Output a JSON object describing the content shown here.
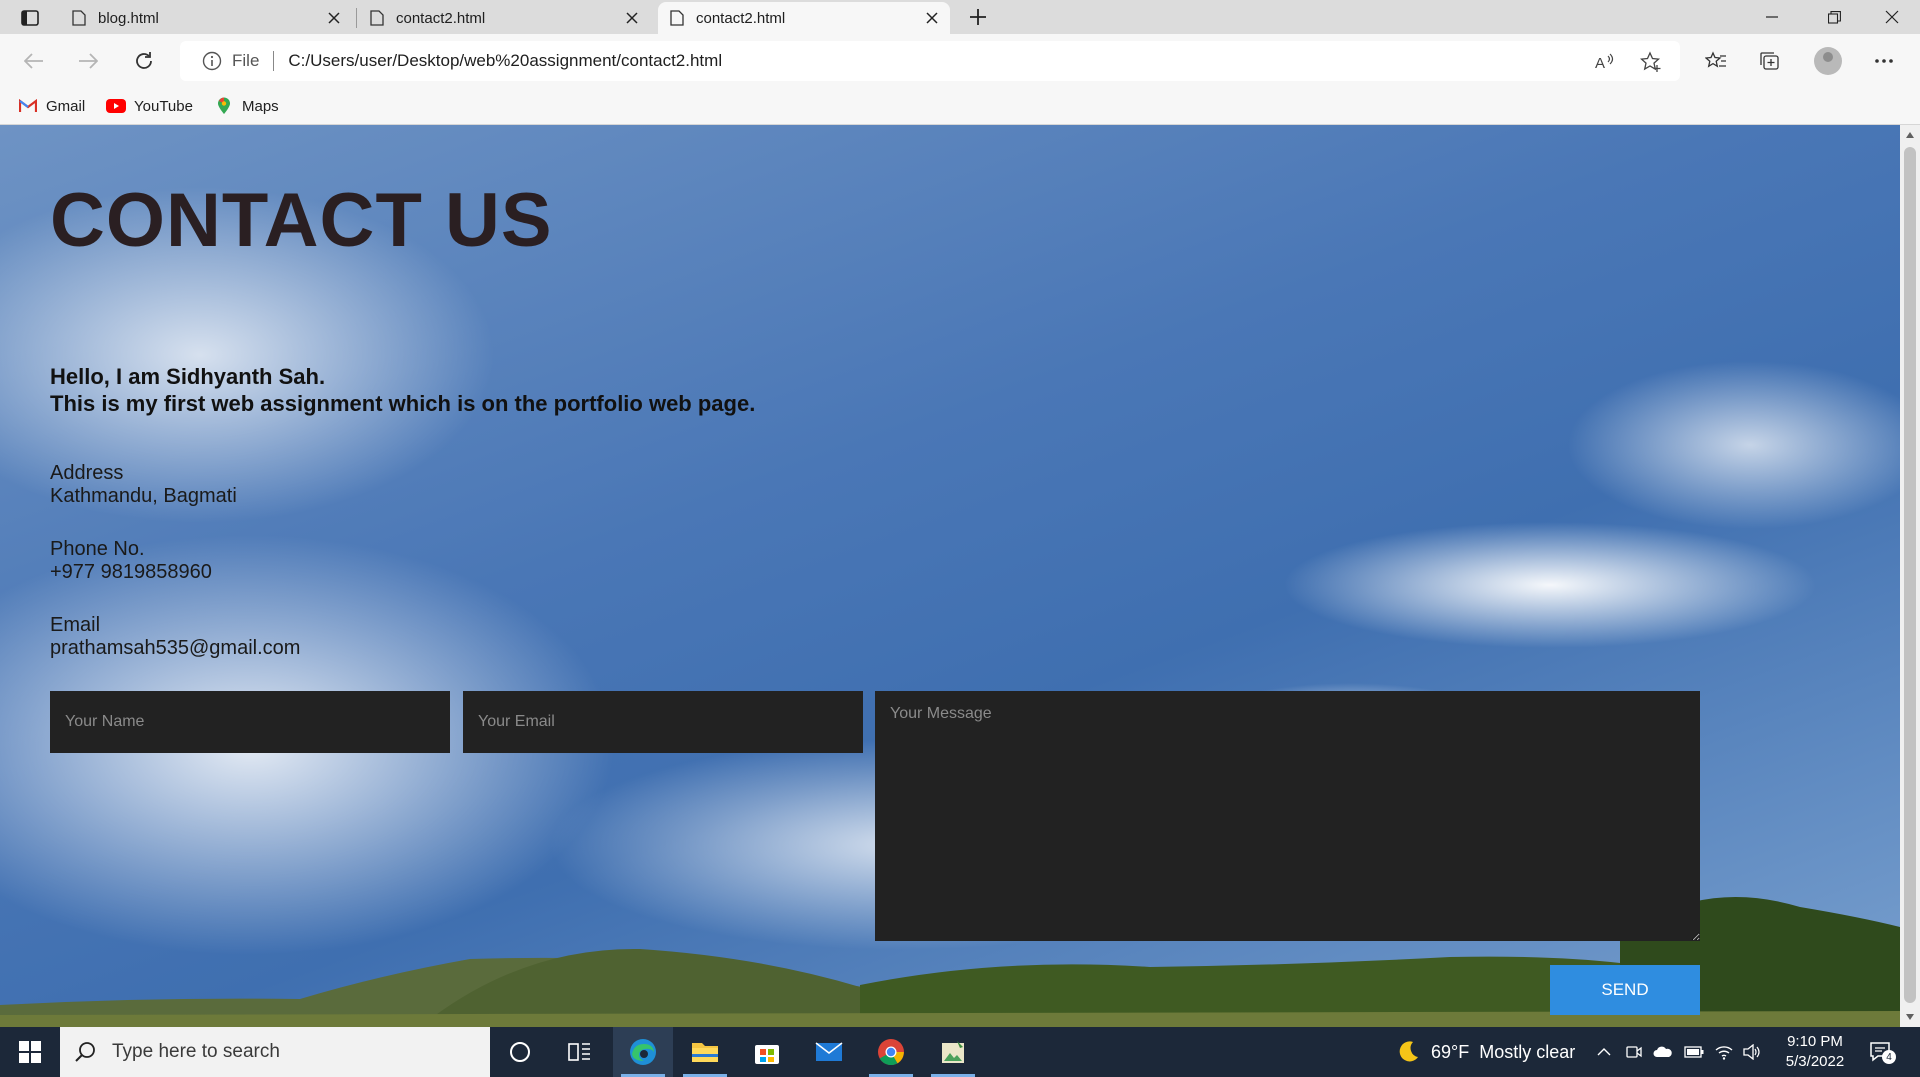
{
  "browser": {
    "tabs": [
      {
        "title": "blog.html",
        "active": false
      },
      {
        "title": "contact2.html",
        "active": false
      },
      {
        "title": "contact2.html",
        "active": true
      }
    ],
    "address": {
      "scheme_label": "File",
      "url": "C:/Users/user/Desktop/web%20assignment/contact2.html"
    },
    "favorites": [
      {
        "label": "Gmail",
        "icon": "gmail-icon"
      },
      {
        "label": "YouTube",
        "icon": "youtube-icon"
      },
      {
        "label": "Maps",
        "icon": "maps-icon"
      }
    ]
  },
  "page": {
    "title": "CONTACT US",
    "intro_line1": "Hello, I am Sidhyanth Sah.",
    "intro_line2": "This is my first web assignment which is on the portfolio web page.",
    "address": {
      "label": "Address",
      "value": "Kathmandu, Bagmati"
    },
    "phone": {
      "label": "Phone No.",
      "value": "+977 9819858960"
    },
    "email": {
      "label": "Email",
      "value": "prathamsah535@gmail.com"
    },
    "form": {
      "name_placeholder": "Your Name",
      "email_placeholder": "Your Email",
      "message_placeholder": "Your Message",
      "send_label": "SEND"
    }
  },
  "taskbar": {
    "search_placeholder": "Type here to search",
    "weather": {
      "temp": "69°F",
      "condition": "Mostly clear"
    },
    "time": "9:10 PM",
    "date": "5/3/2022",
    "notification_count": "4"
  },
  "colors": {
    "send_button": "#2f8de0",
    "field_background": "#222222",
    "title_color": "#2a1f22",
    "taskbar": "#1c2839"
  }
}
